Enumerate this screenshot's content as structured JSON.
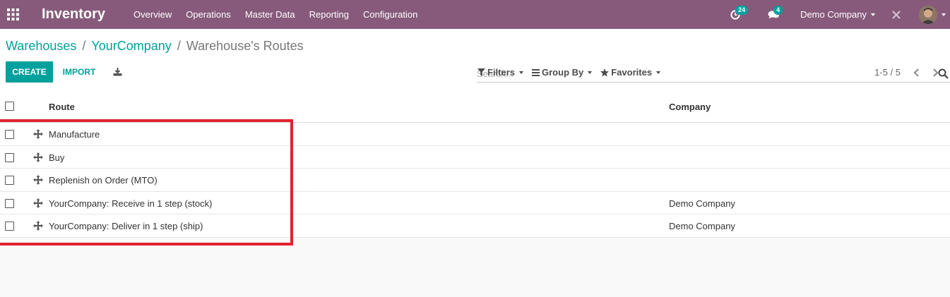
{
  "navbar": {
    "app_name": "Inventory",
    "menu": [
      "Overview",
      "Operations",
      "Master Data",
      "Reporting",
      "Configuration"
    ],
    "activity_count": "24",
    "message_count": "4",
    "company": "Demo Company",
    "bg_color": "#875a7b"
  },
  "breadcrumb": {
    "items": [
      "Warehouses",
      "YourCompany"
    ],
    "current": "Warehouse's Routes"
  },
  "search": {
    "placeholder": "Search..."
  },
  "buttons": {
    "create": "CREATE",
    "import": "IMPORT"
  },
  "filters": {
    "filters": "Filters",
    "group_by": "Group By",
    "favorites": "Favorites"
  },
  "pager": {
    "text": "1-5 / 5"
  },
  "list": {
    "columns": {
      "route": "Route",
      "company": "Company"
    },
    "rows": [
      {
        "route": "Manufacture",
        "company": ""
      },
      {
        "route": "Buy",
        "company": ""
      },
      {
        "route": "Replenish on Order (MTO)",
        "company": ""
      },
      {
        "route": "YourCompany: Receive in 1 step (stock)",
        "company": "Demo Company"
      },
      {
        "route": "YourCompany: Deliver in 1 step (ship)",
        "company": "Demo Company"
      }
    ]
  },
  "colors": {
    "accent": "#00a09d",
    "highlight": "#e0232d"
  }
}
